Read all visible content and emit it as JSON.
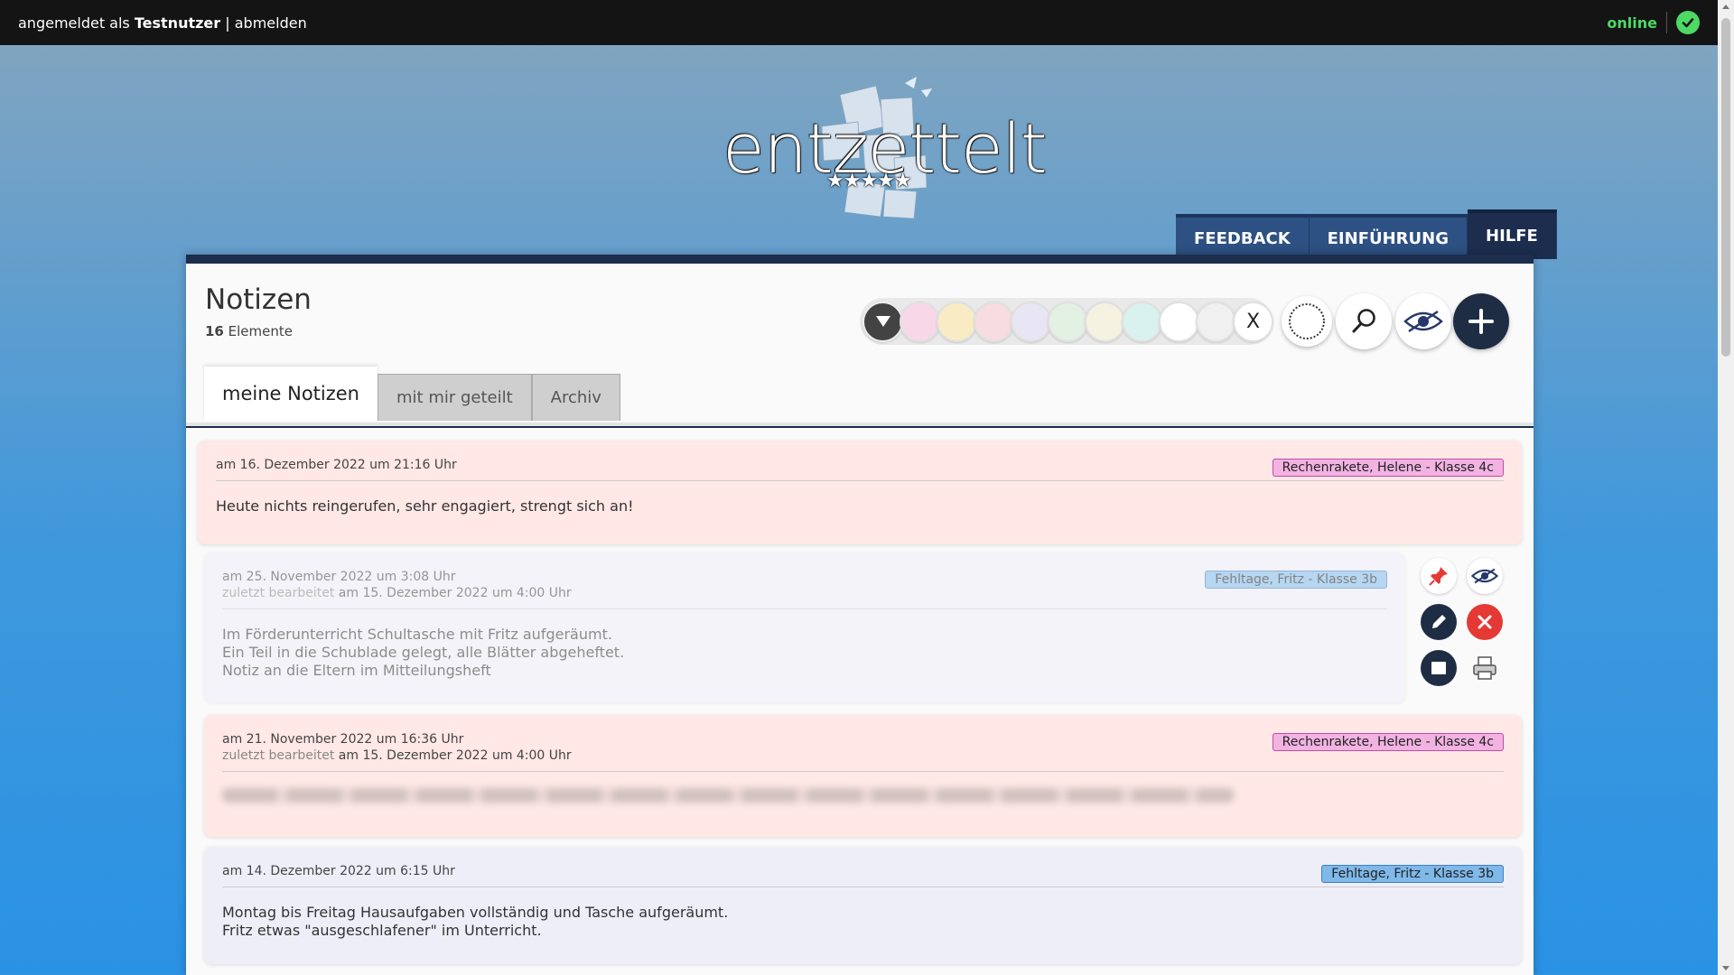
{
  "topbar": {
    "prefix": "angemeldet als",
    "username": "Testnutzer",
    "separator": "|",
    "logout": "abmelden",
    "status": "online"
  },
  "logo": {
    "text": "entzettelt",
    "stars": "★★★★★"
  },
  "nav": [
    {
      "label": "FEEDBACK"
    },
    {
      "label": "EINFÜHRUNG"
    },
    {
      "label": "HILFE"
    }
  ],
  "header": {
    "title": "Notizen",
    "count": "16",
    "count_label": "Elemente"
  },
  "toolbar": {
    "colors": [
      "#f8d7e8",
      "#f9ecc5",
      "#f7dce0",
      "#e8e5f5",
      "#e3f1e3",
      "#f5f2e1",
      "#d9f1ef",
      "#ffffff",
      "#f0f0f0"
    ],
    "clear_label": "X",
    "icons": [
      "filter-dropdown-icon",
      "circle-outline-icon",
      "search-icon",
      "hide-icon",
      "plus-icon"
    ]
  },
  "tabs": [
    {
      "label": "meine Notizen"
    },
    {
      "label": "mit mir geteilt"
    },
    {
      "label": "Archiv"
    }
  ],
  "notes": [
    {
      "date": "am 16. Dezember 2022 um 21:16 Uhr",
      "tag": "Rechenrakete, Helene - Klasse 4c",
      "body": [
        "Heute nichts reingerufen, sehr engagiert, strengt sich an!"
      ]
    },
    {
      "date": "am 25. November 2022 um 3:08 Uhr",
      "edited_prefix": "zuletzt bearbeitet",
      "edited": "am 15. Dezember 2022 um 4:00 Uhr",
      "tag": "Fehltage, Fritz - Klasse 3b",
      "body": [
        "Im Förderunterricht Schultasche mit Fritz aufgeräumt.",
        "Ein Teil in die Schublade gelegt, alle Blätter abgeheftet.",
        "Notiz an die Eltern im Mitteilungsheft"
      ]
    },
    {
      "date": "am 21. November 2022 um 16:36 Uhr",
      "edited_prefix": "zuletzt bearbeitet",
      "edited": "am 15. Dezember 2022 um 4:00 Uhr",
      "tag": "Rechenrakete, Helene - Klasse 4c"
    },
    {
      "date": "am 14. Dezember 2022 um 6:15 Uhr",
      "tag": "Fehltage, Fritz - Klasse 3b",
      "body": [
        "Montag bis Freitag Hausaufgaben vollständig und Tasche aufgeräumt.",
        "Fritz etwas \"ausgeschlafener\" im Unterricht."
      ]
    }
  ],
  "colors": {
    "note_pink": "#ffe8e6",
    "note_lavender": "#eeeef9",
    "tag_pink": "#f2b3e3",
    "tag_blue": "#7fb9ea",
    "nav_blue": "#2d5182",
    "nav_active": "#1c2d4e"
  }
}
